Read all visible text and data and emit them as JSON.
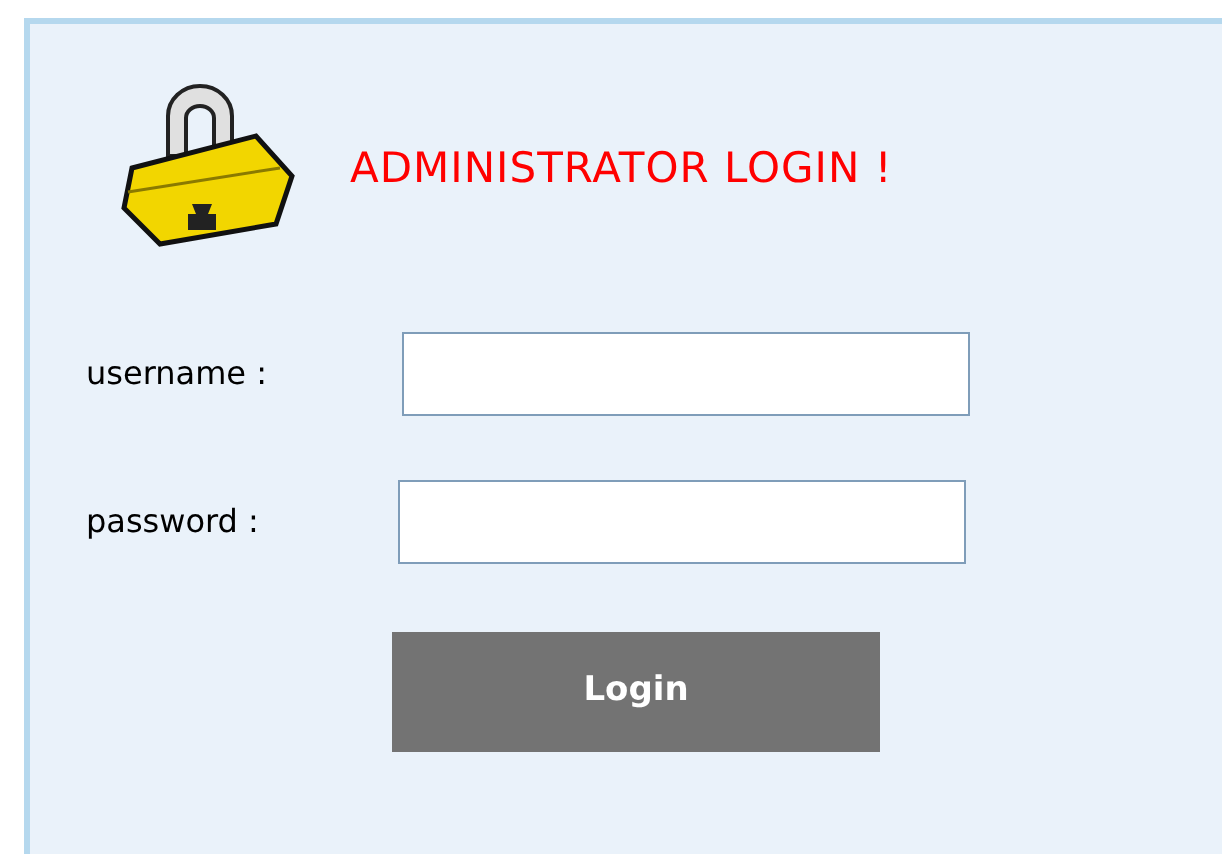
{
  "title": "ADMINISTRATOR LOGIN !",
  "fields": [
    {
      "label": "username :"
    },
    {
      "label": "password :"
    }
  ],
  "button": "Login"
}
